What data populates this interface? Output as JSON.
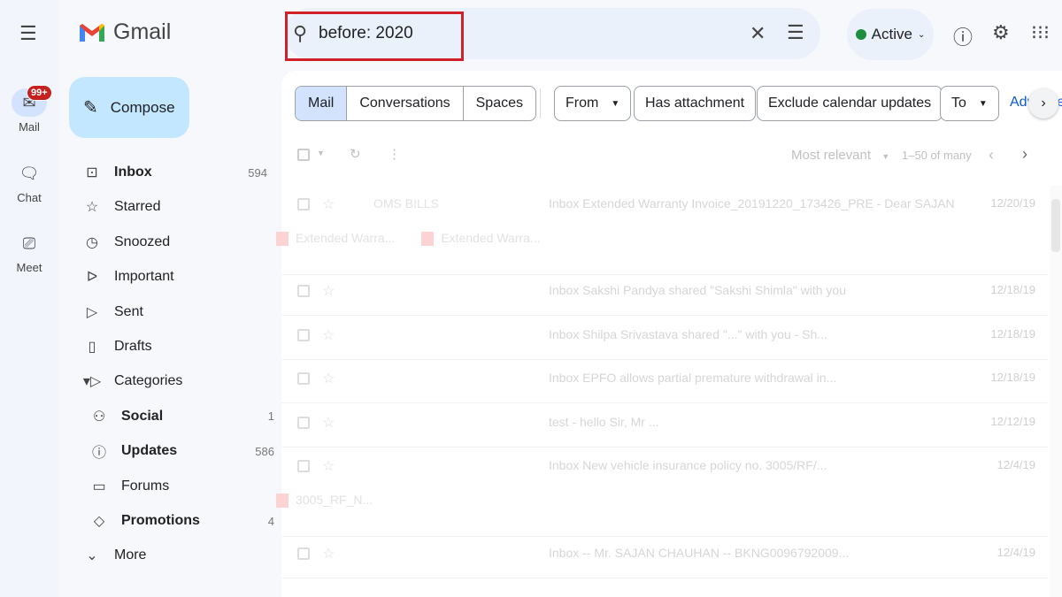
{
  "app": {
    "name": "Gmail"
  },
  "rail": [
    {
      "label": "Mail",
      "icon": "mail-icon",
      "badge": "99+"
    },
    {
      "label": "Chat",
      "icon": "chat-icon"
    },
    {
      "label": "Meet",
      "icon": "video-icon"
    }
  ],
  "compose": "Compose",
  "nav": [
    {
      "label": "Inbox",
      "count": "594",
      "icon": "inbox-icon",
      "bold": true
    },
    {
      "label": "Starred",
      "icon": "star-icon"
    },
    {
      "label": "Snoozed",
      "icon": "clock-icon"
    },
    {
      "label": "Important",
      "icon": "important-icon"
    },
    {
      "label": "Sent",
      "icon": "send-icon"
    },
    {
      "label": "Drafts",
      "icon": "draft-icon"
    },
    {
      "label": "Categories",
      "icon": "label-icon"
    },
    {
      "label": "Social",
      "count": "1",
      "icon": "people-icon",
      "bold": true
    },
    {
      "label": "Updates",
      "count": "586",
      "icon": "info-icon",
      "bold": true
    },
    {
      "label": "Forums",
      "icon": "forum-icon"
    },
    {
      "label": "Promotions",
      "count": "4",
      "icon": "tag-icon",
      "bold": true
    },
    {
      "label": "More",
      "icon": "chevron-down-icon"
    }
  ],
  "search": {
    "value": "before: 2020"
  },
  "status": {
    "label": "Active",
    "color": "#1e8e3e"
  },
  "tabs": [
    "Mail",
    "Conversations",
    "Spaces"
  ],
  "filters": {
    "from": "From",
    "has_attachment": "Has attachment",
    "exclude": "Exclude calendar updates",
    "to": "To",
    "advanced": "Advanced search"
  },
  "toolbar": {
    "sort": "Most relevant",
    "range": "1–50 of many"
  },
  "emails": [
    {
      "sender": "OMS BILLS",
      "subject": "Inbox  Extended Warranty Invoice_20191220_173426_PRE - Dear SAJAN ...",
      "date": "12/20/19",
      "attachments": [
        "Extended Warra...",
        "Extended Warra..."
      ]
    },
    {
      "subject": "Inbox  Sakshi Pandya shared \"Sakshi Shimla\" with you",
      "date": "12/18/19"
    },
    {
      "subject": "Inbox  Shilpa Srivastava shared \"...\" with you - Sh...",
      "date": "12/18/19"
    },
    {
      "subject": "Inbox  EPFO allows partial premature withdrawal in...",
      "date": "12/18/19"
    },
    {
      "subject": "test - hello Sir, Mr ...",
      "date": "12/12/19"
    },
    {
      "subject": "Inbox  New vehicle insurance policy no. 3005/RF/...",
      "date": "12/4/19",
      "attachments": [
        "3005_RF_N..."
      ]
    },
    {
      "subject": "Inbox  -- Mr. SAJAN CHAUHAN -- BKNG0096792009...",
      "date": "12/4/19"
    }
  ]
}
